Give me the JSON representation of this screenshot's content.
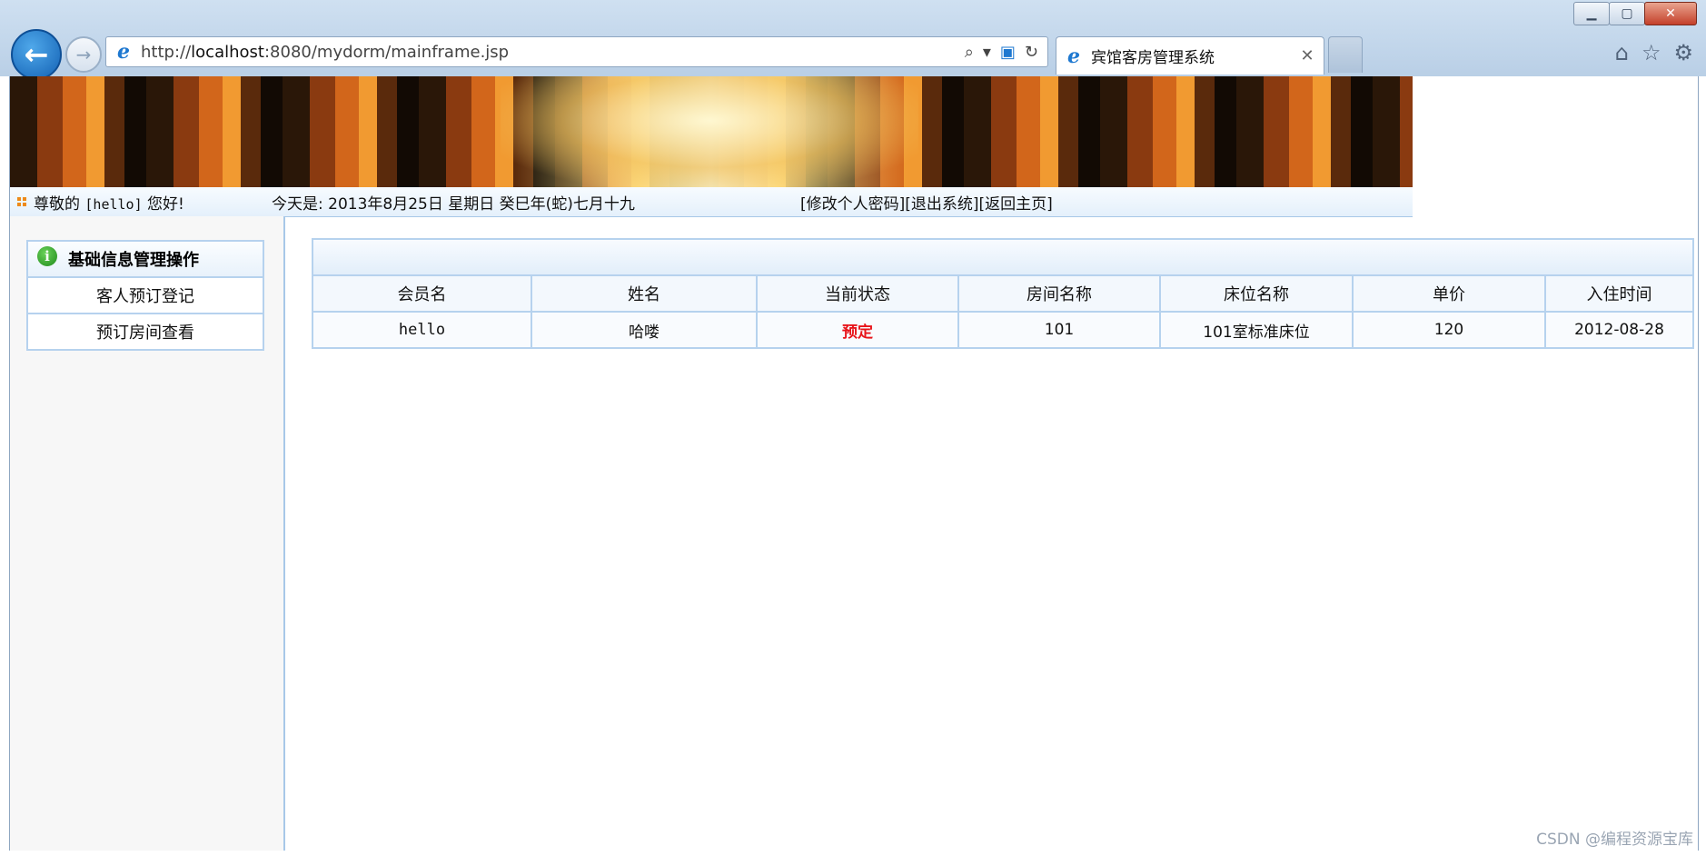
{
  "browser": {
    "url_prefix": "http://",
    "url_host": "localhost",
    "url_rest": ":8080/mydorm/mainframe.jsp",
    "tab_title": "宾馆客房管理系统",
    "back_icon": "arrow-left-icon",
    "forward_icon": "arrow-right-icon",
    "window_controls": [
      "minimize",
      "maximize",
      "close"
    ]
  },
  "topbar": {
    "greeting_prefix": "尊敬的",
    "username": "[hello]",
    "greeting_suffix": "您好!",
    "today": "今天是:  2013年8月25日 星期日 癸巳年(蛇)七月十九",
    "links": [
      "[修改个人密码]",
      "[退出系统]",
      "[返回主页]"
    ]
  },
  "sidebar": {
    "section_title": "基础信息管理操作",
    "items": [
      "客人预订登记",
      "预订房间查看"
    ]
  },
  "table": {
    "columns": [
      "会员名",
      "姓名",
      "当前状态",
      "房间名称",
      "床位名称",
      "单价",
      "入住时间"
    ],
    "rows": [
      [
        "hello",
        "哈喽",
        "预定",
        "101",
        "101室标准床位",
        "120",
        "2012-08-28"
      ]
    ]
  },
  "watermark": "CSDN @编程资源宝库",
  "colors": {
    "accent_border": "#b6d2ee",
    "status_red": "#e8141a",
    "ie_blue": "#1e78d0"
  }
}
